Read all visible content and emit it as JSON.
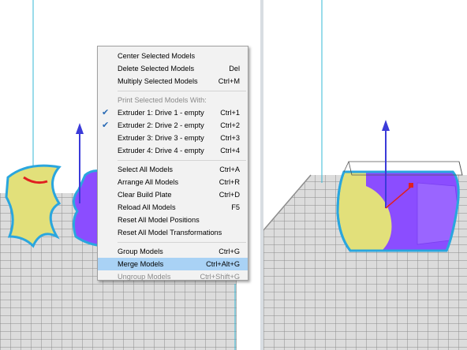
{
  "context_menu": {
    "items": [
      {
        "type": "item",
        "label": "Center Selected Models",
        "shortcut": "",
        "checked": false,
        "disabled": false,
        "highlighted": false
      },
      {
        "type": "item",
        "label": "Delete Selected Models",
        "shortcut": "Del",
        "checked": false,
        "disabled": false,
        "highlighted": false
      },
      {
        "type": "item",
        "label": "Multiply Selected Models",
        "shortcut": "Ctrl+M",
        "checked": false,
        "disabled": false,
        "highlighted": false
      },
      {
        "type": "separator"
      },
      {
        "type": "header",
        "label": "Print Selected Models With:",
        "shortcut": ""
      },
      {
        "type": "item",
        "label": "Extruder 1: Drive 1 - empty",
        "shortcut": "Ctrl+1",
        "checked": true,
        "disabled": false,
        "highlighted": false
      },
      {
        "type": "item",
        "label": "Extruder 2: Drive 2 - empty",
        "shortcut": "Ctrl+2",
        "checked": true,
        "disabled": false,
        "highlighted": false
      },
      {
        "type": "item",
        "label": "Extruder 3: Drive 3 - empty",
        "shortcut": "Ctrl+3",
        "checked": false,
        "disabled": false,
        "highlighted": false
      },
      {
        "type": "item",
        "label": "Extruder 4: Drive 4 - empty",
        "shortcut": "Ctrl+4",
        "checked": false,
        "disabled": false,
        "highlighted": false
      },
      {
        "type": "separator"
      },
      {
        "type": "item",
        "label": "Select All Models",
        "shortcut": "Ctrl+A",
        "checked": false,
        "disabled": false,
        "highlighted": false
      },
      {
        "type": "item",
        "label": "Arrange All Models",
        "shortcut": "Ctrl+R",
        "checked": false,
        "disabled": false,
        "highlighted": false
      },
      {
        "type": "item",
        "label": "Clear Build Plate",
        "shortcut": "Ctrl+D",
        "checked": false,
        "disabled": false,
        "highlighted": false
      },
      {
        "type": "item",
        "label": "Reload All Models",
        "shortcut": "F5",
        "checked": false,
        "disabled": false,
        "highlighted": false
      },
      {
        "type": "item",
        "label": "Reset All Model Positions",
        "shortcut": "",
        "checked": false,
        "disabled": false,
        "highlighted": false
      },
      {
        "type": "item",
        "label": "Reset All Model Transformations",
        "shortcut": "",
        "checked": false,
        "disabled": false,
        "highlighted": false
      },
      {
        "type": "separator"
      },
      {
        "type": "item",
        "label": "Group Models",
        "shortcut": "Ctrl+G",
        "checked": false,
        "disabled": false,
        "highlighted": false
      },
      {
        "type": "item",
        "label": "Merge Models",
        "shortcut": "Ctrl+Alt+G",
        "checked": false,
        "disabled": false,
        "highlighted": true
      },
      {
        "type": "item",
        "label": "Ungroup Models",
        "shortcut": "Ctrl+Shift+G",
        "checked": false,
        "disabled": true,
        "highlighted": false
      }
    ]
  },
  "icons": {
    "check": "checkmark-icon"
  },
  "colors": {
    "grid_line": "#8c8c8c",
    "plate": "#d9d9d9",
    "model_yellow": "#e2e07a",
    "model_purple": "#8b4dff",
    "model_outline": "#2aa6de",
    "axis_blue": "#3b3bd9",
    "axis_red": "#e02020",
    "axis_green": "#2db24a",
    "axis_cyan": "#36b8d6",
    "menu_bg": "#f2f2f2",
    "menu_highlight": "#a9d2f5"
  }
}
